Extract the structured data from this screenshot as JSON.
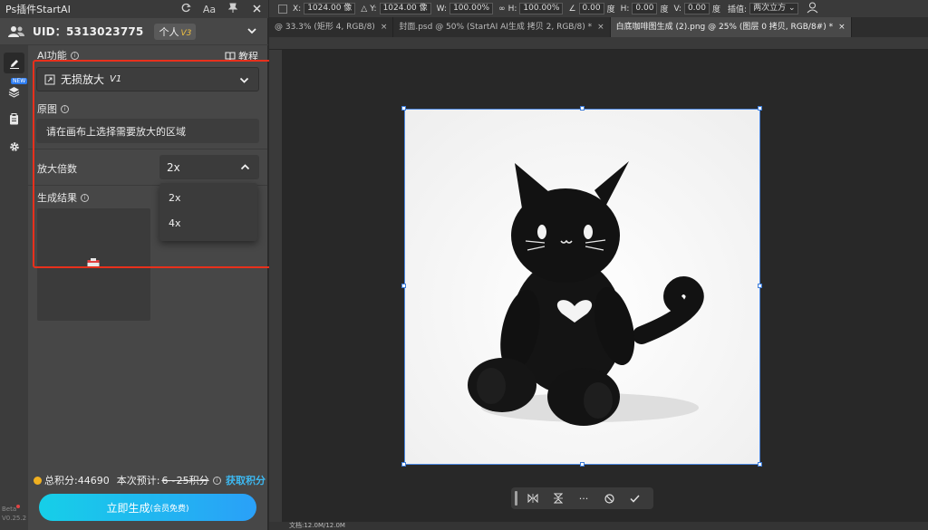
{
  "plugin": {
    "title": "Ps插件StartAI",
    "user": {
      "uid_label": "UID：",
      "uid": "5313023775",
      "tier": "个人",
      "tier_level": "V3"
    },
    "section_ai": "AI功能",
    "tutorial": "教程",
    "feature_name": "无损放大",
    "feature_version": "V1",
    "source_label": "原图",
    "source_hint": "请在画布上选择需要放大的区域",
    "scale_label": "放大倍数",
    "scale_value": "2x",
    "scale_options": [
      "2x",
      "4x"
    ],
    "result_label": "生成结果",
    "points_label": "总积分:",
    "points_value": "44690",
    "estimate_label": "本次预计:",
    "estimate_range": "6~25积分",
    "get_points": "获取积分",
    "generate_btn": "立即生成",
    "generate_sub": "(会员免费)",
    "version_beta": "Beta",
    "version": "V0.25.2",
    "new_badge": "NEW"
  },
  "options_bar": {
    "x_label": "X:",
    "x_value": "1024.00 像",
    "y_label": "Y:",
    "y_value": "1024.00 像",
    "w_label": "W:",
    "w_value": "100.00%",
    "h_label": "H:",
    "h_value": "100.00%",
    "angle_value": "0.00",
    "angle_unit": "度",
    "hskew_label": "H:",
    "hskew_value": "0.00",
    "hskew_unit": "度",
    "vskew_label": "V:",
    "vskew_value": "0.00",
    "vskew_unit": "度",
    "interp_label": "插值:",
    "interp_value": "两次立方"
  },
  "tabs": [
    {
      "label": "@ 33.3% (矩形 4, RGB/8)",
      "active": false
    },
    {
      "label": "封面.psd @ 50% (StartAI AI生成 拷贝 2, RGB/8) *",
      "active": false
    },
    {
      "label": "白底咖啡图生成 (2).png @ 25% (图层 0 拷贝, RGB/8#) *",
      "active": true
    }
  ],
  "status": {
    "doc_info": "文档:12.0M/12.0M"
  },
  "colors": {
    "accent_highlight": "#e8301c",
    "generate_start": "#16cfe8",
    "generate_end": "#2aa0f8",
    "link": "#3db8f0",
    "coin": "#f0b020"
  }
}
